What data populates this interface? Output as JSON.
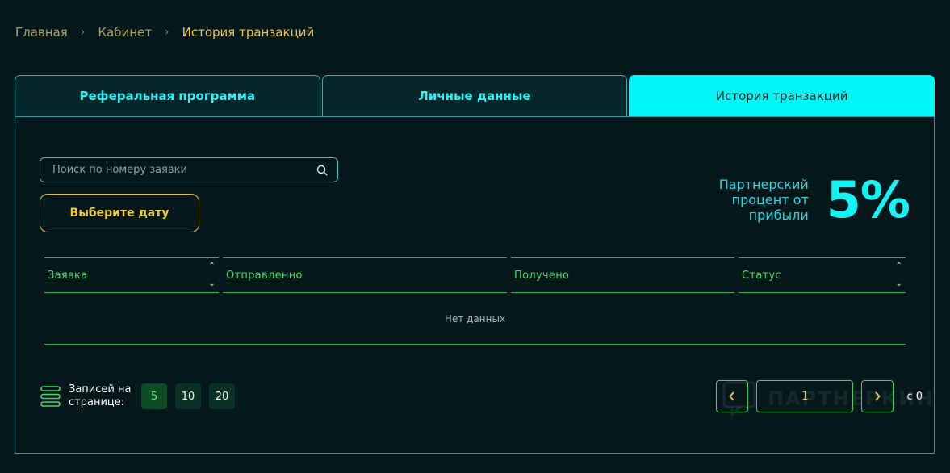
{
  "breadcrumb": {
    "items": [
      "Главная",
      "Кабинет",
      "История транзакций"
    ]
  },
  "tabs": [
    {
      "label": "Реферальная программа",
      "active": false
    },
    {
      "label": "Личные данные",
      "active": false
    },
    {
      "label": "История транзакций",
      "active": true
    }
  ],
  "search": {
    "placeholder": "Поиск по номеру заявки",
    "icon": "search-icon"
  },
  "date_button": {
    "label": "Выберите дату"
  },
  "partner": {
    "label": "Партнерский процент от прибыли",
    "value": "5%"
  },
  "table": {
    "columns": [
      {
        "label": "Заявка",
        "sortable": true
      },
      {
        "label": "Отправленно",
        "sortable": false
      },
      {
        "label": "Получено",
        "sortable": false
      },
      {
        "label": "Статус",
        "sortable": true
      }
    ],
    "empty_text": "Нет данных"
  },
  "per_page": {
    "label": "Записей на странице:",
    "options": [
      "5",
      "10",
      "20"
    ],
    "selected": "5"
  },
  "pagination": {
    "current": "1",
    "total_label": "с 0"
  },
  "watermark": {
    "text": "ПАРТНЕРКИН"
  },
  "colors": {
    "background": "#04171a",
    "accent_cyan": "#00f7f7",
    "accent_yellow": "#f0cf45",
    "accent_green": "#3fdc6b"
  }
}
